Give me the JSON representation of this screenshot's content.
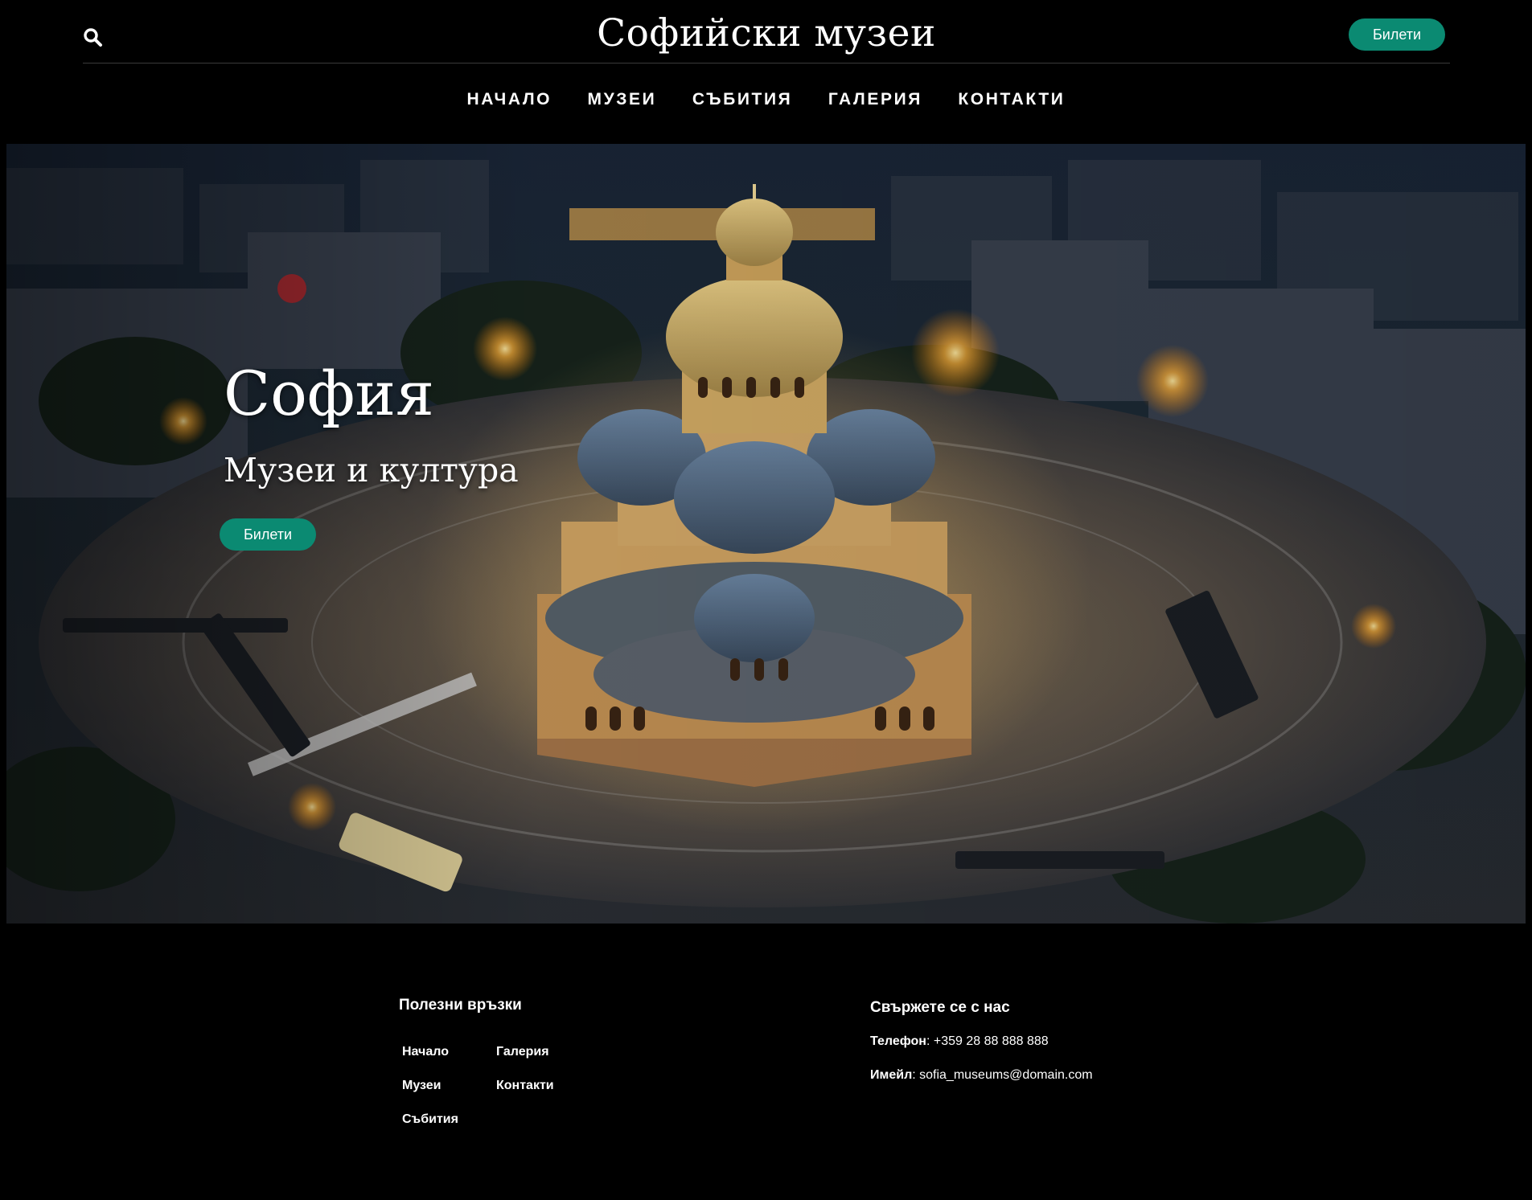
{
  "header": {
    "site_title": "Софийски музеи",
    "ticket_button": "Билети",
    "search_icon": "search-icon"
  },
  "nav": {
    "items": [
      "НАЧАЛО",
      "МУЗЕИ",
      "СЪБИТИЯ",
      "ГАЛЕРИЯ",
      "КОНТАКТИ"
    ]
  },
  "hero": {
    "title": "София",
    "subtitle": "Музеи и култура",
    "ticket_button": "Билети"
  },
  "footer": {
    "links_heading": "Полезни връзки",
    "links": [
      "Начало",
      "Галерия",
      "Музеи",
      "Контакти",
      "Събития"
    ],
    "contact_heading": "Свържете се с нас",
    "phone_label": "Телефон",
    "phone_value": "+359 28 88 888 888",
    "email_label": "Имейл",
    "email_value": "sofia_museums@domain.com"
  },
  "colors": {
    "background": "#000000",
    "accent": "#0b8a72",
    "text": "#ffffff"
  }
}
